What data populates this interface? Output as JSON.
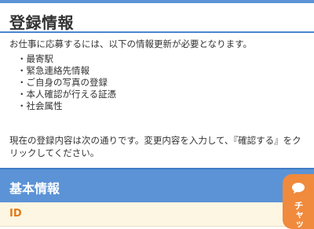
{
  "header": {
    "title": "登録情報"
  },
  "intro_text": "お仕事に応募するには、以下の情報更新が必要となります。",
  "requirements": [
    "・最寄駅",
    "・緊急連絡先情報",
    "・ご自身の写真の登録",
    "・本人確認が行える証憑",
    "・社会属性"
  ],
  "status_text": "現在の登録内容は次の通りです。変更内容を入力して、『確認する』をクリックしてください。",
  "section": {
    "title": "基本情報",
    "field_label": "ID"
  },
  "chat": {
    "label": "チャッ",
    "icon": "chat-bubble-icon",
    "color": "#f08a3c"
  },
  "colors": {
    "accent": "#5b93d6",
    "label": "#e07b1a",
    "field_bg": "#fdf6e3"
  }
}
